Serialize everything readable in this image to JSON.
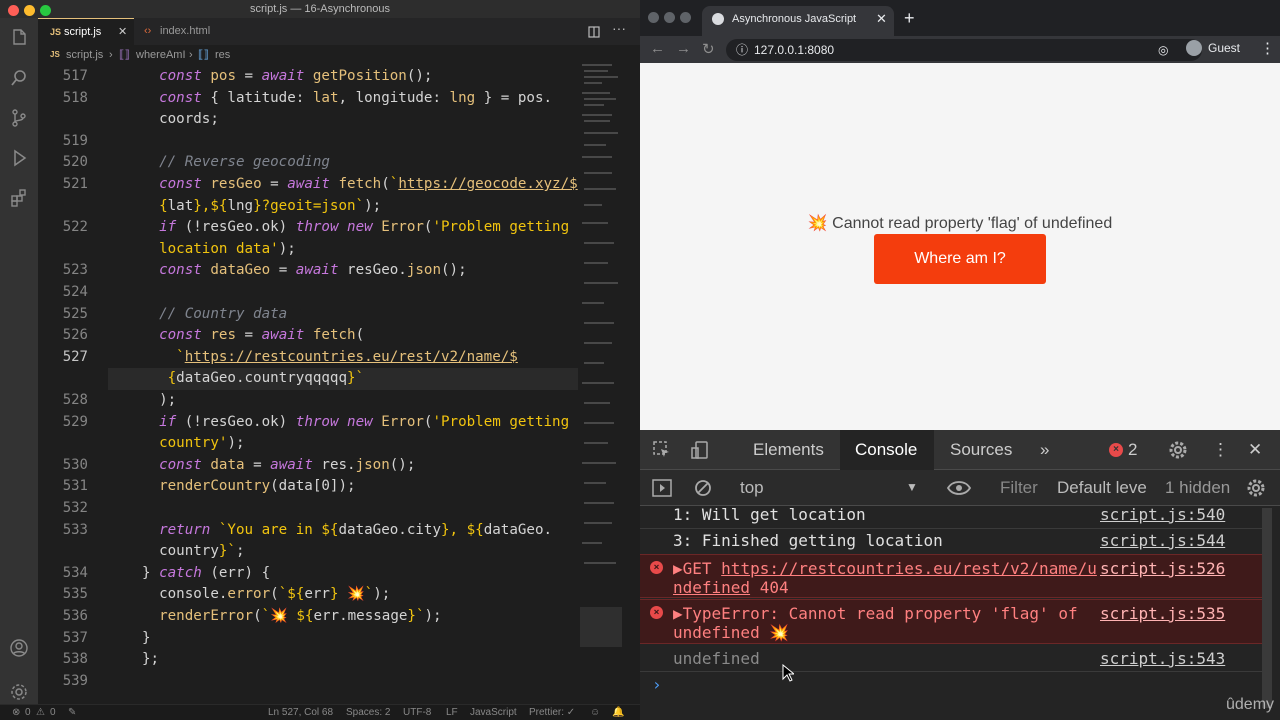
{
  "editor": {
    "window_title": "script.js — 16-Asynchronous",
    "tabs": [
      {
        "label": "script.js"
      },
      {
        "label": "index.html"
      }
    ],
    "breadcrumb": {
      "file": "script.js",
      "fn": "whereAmI",
      "var": "res"
    },
    "gutter": [
      "517",
      "518",
      "",
      "519",
      "520",
      "521",
      "",
      "522",
      "",
      "523",
      "524",
      "525",
      "526",
      "527",
      "",
      "528",
      "529",
      "",
      "530",
      "531",
      "532",
      "533",
      "",
      "534",
      "535",
      "536",
      "537",
      "538",
      "539"
    ],
    "status": {
      "problems": "0",
      "warnings": "0",
      "position": "Ln 527, Col 68",
      "spaces": "Spaces: 2",
      "encoding": "UTF-8",
      "eol": "LF",
      "language": "JavaScript",
      "formatter": "Prettier: ✓"
    }
  },
  "browser": {
    "tab_title": "Asynchronous JavaScript",
    "url": "127.0.0.1:8080",
    "profile": "Guest",
    "page": {
      "error_text": "💥 Cannot read property 'flag' of undefined",
      "button_label": "Where am I?"
    }
  },
  "devtools": {
    "tabs": [
      "Elements",
      "Console",
      "Sources"
    ],
    "more": "»",
    "error_count": "2",
    "context": "top",
    "filter_placeholder": "Filter",
    "levels": "Default leve",
    "hidden": "1 hidden",
    "logs": [
      {
        "type": "log",
        "text": "1: Will get location",
        "source": "script.js:540"
      },
      {
        "type": "log",
        "text": "3: Finished getting location",
        "source": "script.js:544"
      },
      {
        "type": "error",
        "prefix": "▶GET ",
        "link": "https://restcountries.eu/rest/v2/name/u",
        "line2_link": "ndefined",
        "line2_rest": " 404",
        "source": "script.js:526"
      },
      {
        "type": "error",
        "prefix": "▶TypeError: Cannot read property 'flag' of",
        "line2_rest": "undefined 💥",
        "source": "script.js:535"
      },
      {
        "type": "result",
        "text": "undefined",
        "source": "script.js:543"
      }
    ],
    "prompt": "›"
  },
  "watermark": "ûdemy"
}
